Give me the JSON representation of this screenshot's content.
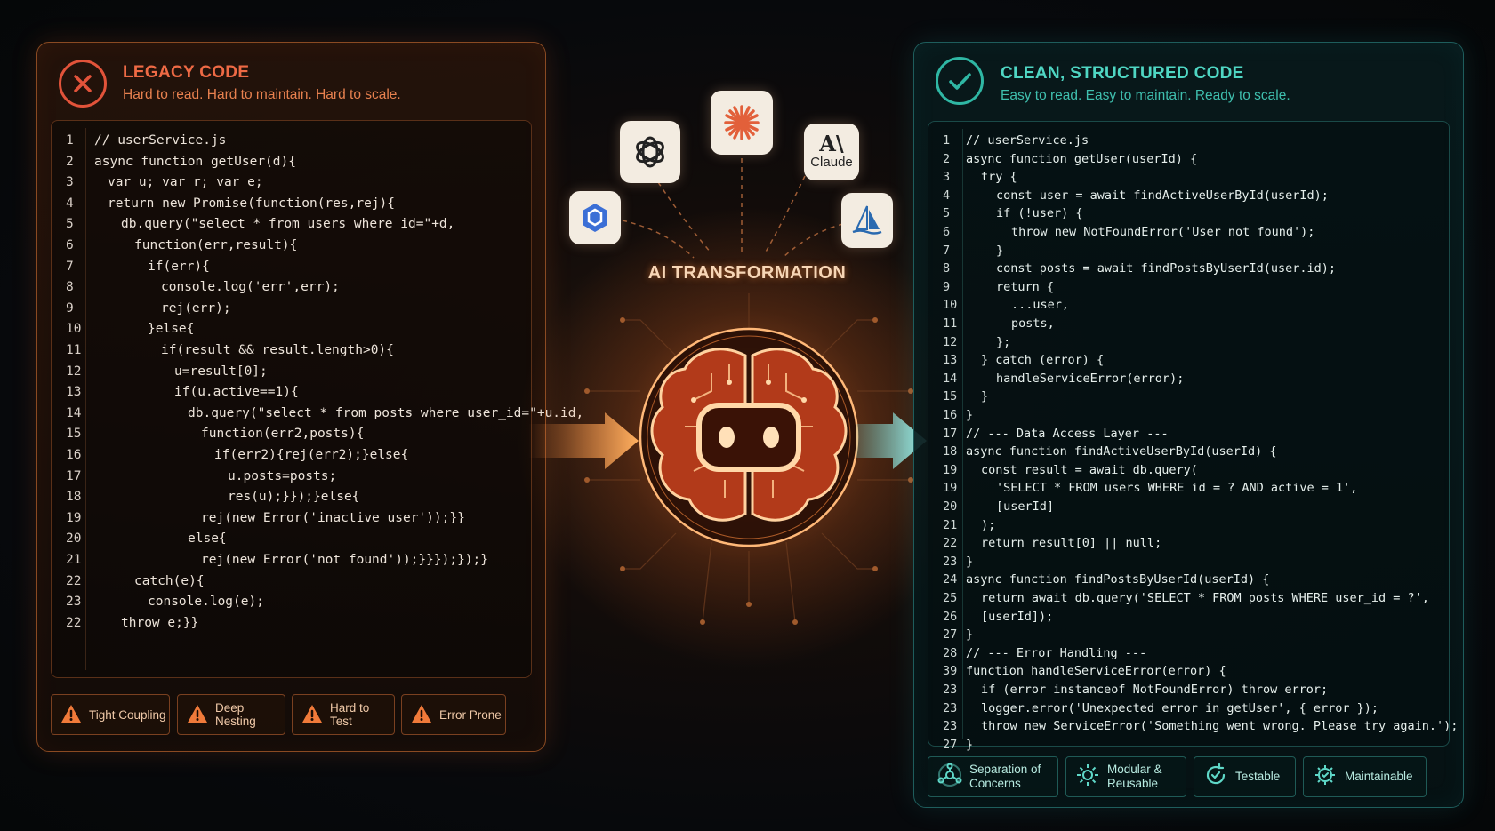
{
  "legacy": {
    "title": "LEGACY CODE",
    "subtitle": "Hard to read. Hard to maintain. Hard to scale.",
    "lines": [
      {
        "n": "1",
        "t": "// userService.js",
        "i": 0
      },
      {
        "n": "2",
        "t": "async function getUser(d){",
        "i": 0
      },
      {
        "n": "3",
        "t": "var u; var r; var e;",
        "i": 1
      },
      {
        "n": "4",
        "t": "return new Promise(function(res,rej){",
        "i": 1
      },
      {
        "n": "5",
        "t": "db.query(\"select * from users where id=\"+d,",
        "i": 2
      },
      {
        "n": "6",
        "t": "function(err,result){",
        "i": 3
      },
      {
        "n": "7",
        "t": "if(err){",
        "i": 4
      },
      {
        "n": "8",
        "t": "console.log('err',err);",
        "i": 5
      },
      {
        "n": "9",
        "t": "rej(err);",
        "i": 5
      },
      {
        "n": "10",
        "t": "}else{",
        "i": 4
      },
      {
        "n": "11",
        "t": "if(result && result.length>0){",
        "i": 5
      },
      {
        "n": "12",
        "t": "u=result[0];",
        "i": 6
      },
      {
        "n": "13",
        "t": "if(u.active==1){",
        "i": 6
      },
      {
        "n": "14",
        "t": "db.query(\"select * from posts where user_id=\"+u.id,",
        "i": 7
      },
      {
        "n": "15",
        "t": "function(err2,posts){",
        "i": 8
      },
      {
        "n": "16",
        "t": "if(err2){rej(err2);}else{",
        "i": 9
      },
      {
        "n": "17",
        "t": "u.posts=posts;",
        "i": 10
      },
      {
        "n": "18",
        "t": "res(u);}});}else{",
        "i": 10
      },
      {
        "n": "19",
        "t": "rej(new Error('inactive user'));}}",
        "i": 8
      },
      {
        "n": "20",
        "t": "else{",
        "i": 7
      },
      {
        "n": "21",
        "t": "rej(new Error('not found'));}}});});}",
        "i": 8
      },
      {
        "n": "22",
        "t": "catch(e){",
        "i": 3
      },
      {
        "n": "23",
        "t": "console.log(e);",
        "i": 4
      },
      {
        "n": "22",
        "t": "throw e;}}",
        "i": 2
      }
    ],
    "badges": [
      "Tight Coupling",
      "Deep Nesting",
      "Hard to Test",
      "Error Prone"
    ]
  },
  "center": {
    "title": "AI TRANSFORMATION",
    "logos": {
      "claude": "Claude",
      "anthropic_mark": "A\\"
    }
  },
  "clean": {
    "title": "CLEAN, STRUCTURED CODE",
    "subtitle": "Easy to read. Easy to maintain. Ready to scale.",
    "lines": [
      {
        "n": "1",
        "t": "// userService.js",
        "i": 0
      },
      {
        "n": "2",
        "t": "async function getUser(userId) {",
        "i": 0
      },
      {
        "n": "3",
        "t": "try {",
        "i": 1
      },
      {
        "n": "4",
        "t": "const user = await findActiveUserById(userId);",
        "i": 2
      },
      {
        "n": "5",
        "t": "if (!user) {",
        "i": 2
      },
      {
        "n": "6",
        "t": "throw new NotFoundError('User not found');",
        "i": 3
      },
      {
        "n": "7",
        "t": "}",
        "i": 2
      },
      {
        "n": "8",
        "t": "const posts = await findPostsByUserId(user.id);",
        "i": 2
      },
      {
        "n": "9",
        "t": "return {",
        "i": 2
      },
      {
        "n": "10",
        "t": "...user,",
        "i": 3
      },
      {
        "n": "11",
        "t": "posts,",
        "i": 3
      },
      {
        "n": "12",
        "t": "};",
        "i": 2
      },
      {
        "n": "13",
        "t": "} catch (error) {",
        "i": 1
      },
      {
        "n": "14",
        "t": "handleServiceError(error);",
        "i": 2
      },
      {
        "n": "15",
        "t": "}",
        "i": 1
      },
      {
        "n": "16",
        "t": "}",
        "i": 0
      },
      {
        "n": "17",
        "t": "// --- Data Access Layer ---",
        "i": 0
      },
      {
        "n": "18",
        "t": "async function findActiveUserById(userId) {",
        "i": 0
      },
      {
        "n": "19",
        "t": "const result = await db.query(",
        "i": 1
      },
      {
        "n": "19",
        "t": "'SELECT * FROM users WHERE id = ? AND active = 1',",
        "i": 2
      },
      {
        "n": "20",
        "t": "[userId]",
        "i": 2
      },
      {
        "n": "21",
        "t": ");",
        "i": 1
      },
      {
        "n": "22",
        "t": "return result[0] || null;",
        "i": 1
      },
      {
        "n": "23",
        "t": "}",
        "i": 0
      },
      {
        "n": "24",
        "t": "async function findPostsByUserId(userId) {",
        "i": 0
      },
      {
        "n": "25",
        "t": "return await db.query('SELECT * FROM posts WHERE user_id = ?',",
        "i": 1
      },
      {
        "n": "26",
        "t": "[userId]);",
        "i": 1
      },
      {
        "n": "27",
        "t": "}",
        "i": 0
      },
      {
        "n": "28",
        "t": "// --- Error Handling ---",
        "i": 0
      },
      {
        "n": "39",
        "t": "function handleServiceError(error) {",
        "i": 0
      },
      {
        "n": "23",
        "t": "if (error instanceof NotFoundError) throw error;",
        "i": 1
      },
      {
        "n": "23",
        "t": "logger.error('Unexpected error in getUser', { error });",
        "i": 1
      },
      {
        "n": "23",
        "t": "throw new ServiceError('Something went wrong. Please try again.');",
        "i": 1
      },
      {
        "n": "27",
        "t": "}",
        "i": 0
      }
    ],
    "badges": [
      {
        "line1": "Separation of",
        "line2": "Concerns",
        "icon": "network-icon"
      },
      {
        "line1": "Modular &",
        "line2": "Reusable",
        "icon": "gear-icon"
      },
      {
        "line1": "Testable",
        "line2": "",
        "icon": "refresh-check-icon"
      },
      {
        "line1": "Maintainable",
        "line2": "",
        "icon": "gear-check-icon"
      }
    ]
  },
  "colors": {
    "legacy_accent": "#ee6a45",
    "clean_accent": "#4fd6c3",
    "glow": "#ff8a3d"
  }
}
